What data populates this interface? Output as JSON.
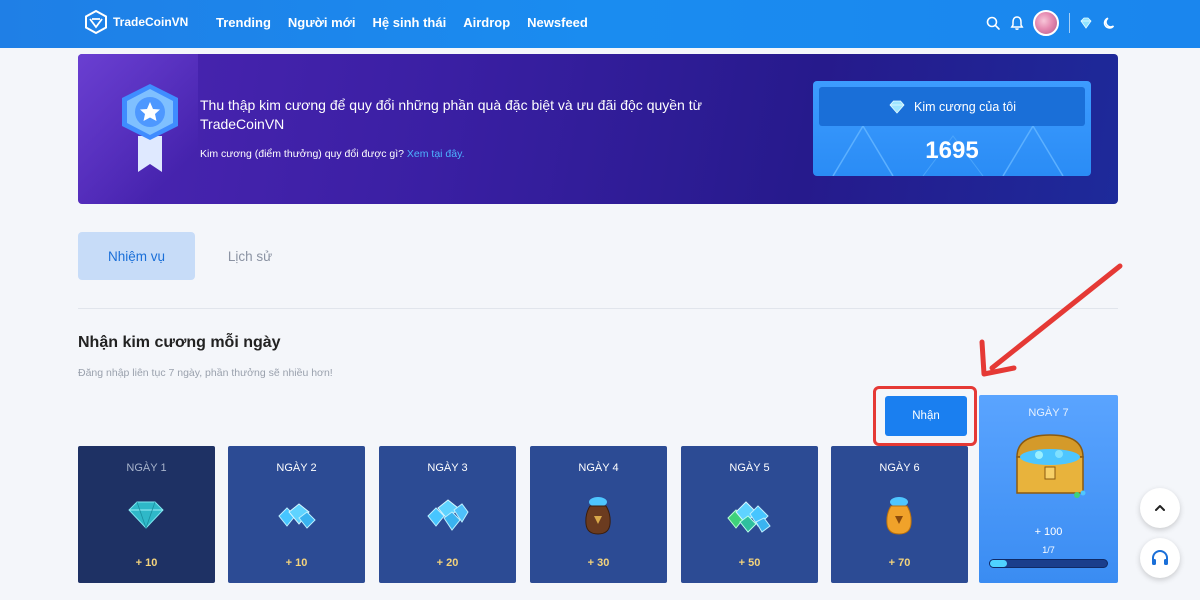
{
  "header": {
    "brand": "TradeCoinVN",
    "nav": [
      "Trending",
      "Người mới",
      "Hệ sinh thái",
      "Airdrop",
      "Newsfeed"
    ],
    "icons": [
      "search-icon",
      "bell-icon",
      "avatar",
      "diamond-icon",
      "moon-icon"
    ]
  },
  "banner": {
    "title": "Thu thập kim cương để quy đổi những phần quà đặc biệt và ưu đãi độc quyền từ TradeCoinVN",
    "subtitle": "Kim cương (điểm thưởng) quy đổi được gì?",
    "link": "Xem tại đây.",
    "card_label": "Kim cương của tôi",
    "card_value": "1695"
  },
  "tabs": {
    "active": "Nhiệm vụ",
    "other": "Lịch sử"
  },
  "daily": {
    "title": "Nhận kim cương mỗi ngày",
    "subtitle": "Đăng nhập liên tục 7 ngày, phần thưởng sẽ nhiều hơn!",
    "claim_label": "Nhận",
    "days": [
      {
        "label": "NGÀY 1",
        "reward": "+ 10"
      },
      {
        "label": "NGÀY 2",
        "reward": "+ 10"
      },
      {
        "label": "NGÀY 3",
        "reward": "+ 20"
      },
      {
        "label": "NGÀY 4",
        "reward": "+ 30"
      },
      {
        "label": "NGÀY 5",
        "reward": "+ 50"
      },
      {
        "label": "NGÀY 6",
        "reward": "+ 70"
      }
    ],
    "day7": {
      "label": "NGÀY 7",
      "reward": "+ 100",
      "progress_text": "1/7",
      "progress": 0.143
    }
  },
  "colors": {
    "header_blue": "#1a86ee",
    "claim_blue": "#1a7ff0",
    "highlight_red": "#e53935",
    "reward_gold": "#f3d37c"
  }
}
